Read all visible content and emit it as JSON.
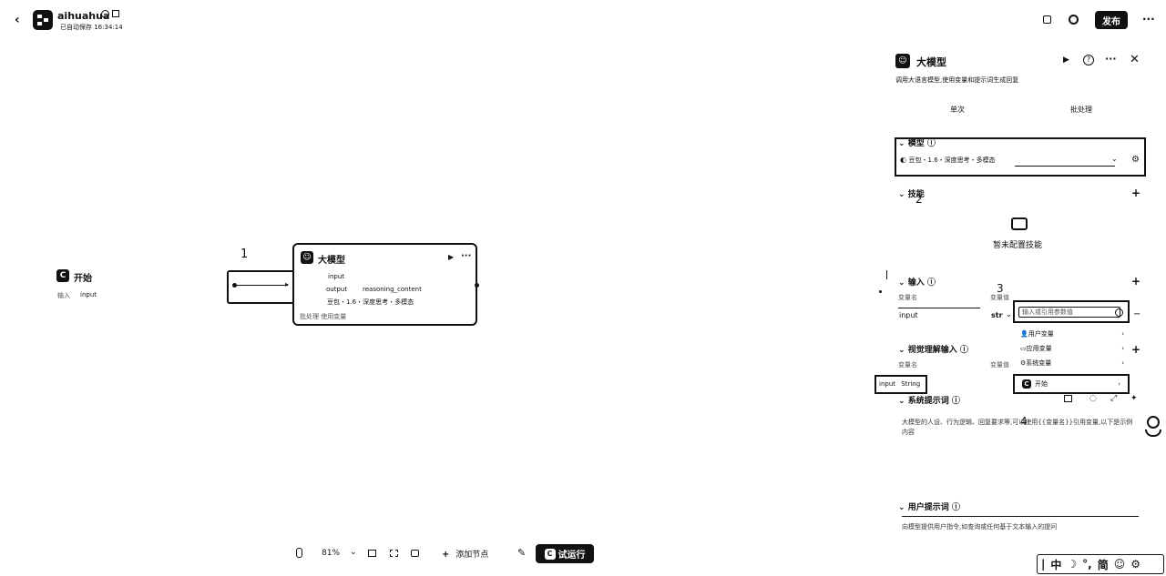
{
  "header": {
    "back_icon": "chevron-left-icon",
    "app_name": "aihuahua",
    "autosave": "已自动保存 16:34:14",
    "publish_label": "发布"
  },
  "canvas": {
    "start_node": {
      "title": "开始",
      "field_label": "输入",
      "field_value": "input"
    },
    "llm_node": {
      "title": "大模型",
      "input_label": "input",
      "outputs": [
        "output",
        "reasoning_content"
      ],
      "model": "豆包・1.6・深度思考・多模态",
      "footer": "批处理 使用变量"
    },
    "annotations": [
      "1",
      "2",
      "3",
      "4"
    ]
  },
  "toolbar": {
    "zoom": "81%",
    "add_node": "添加节点",
    "run": "试运行"
  },
  "panel": {
    "title": "大模型",
    "description": "调用大语言模型,使用变量和提示词生成回复",
    "tabs": [
      "单次",
      "批处理"
    ],
    "model_section": "模型",
    "model_value": "豆包・1.6・深度思考・多模态",
    "skills_section": "技能",
    "skills_empty": "暂未配置技能",
    "input_section": "输入",
    "col_var_name": "变量名",
    "col_var_value": "变量值",
    "input_row_name": "input",
    "input_row_type": "str",
    "input_placeholder": "输入或引用参数值",
    "dropdown_items": [
      "用户变量",
      "应用变量",
      "系统变量",
      "开始"
    ],
    "visual_section": "视觉理解输入",
    "var_name2": "变量名",
    "var_value2": "变量值",
    "chip_label": "input",
    "chip_type": "String",
    "system_prompt_section": "系统提示词",
    "system_prompt_text": "大模型的人设、行为逻辑、回复要求等,可以使用{{变量名}}引用变量,以下是示例内容",
    "user_prompt_section": "用户提示词",
    "user_prompt_text": "向模型提供用户指令,如查询或任何基于文本输入的提问"
  },
  "ime": {
    "items": [
      "中",
      "简"
    ]
  }
}
